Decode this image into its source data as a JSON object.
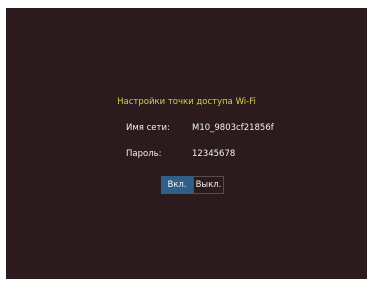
{
  "dialog": {
    "title": "Настройки точки доступа Wi-Fi",
    "network_name_label": "Имя сети:",
    "network_name_value": "M10_9803cf21856f",
    "password_label": "Пароль:",
    "password_value": "12345678",
    "on_button_label": "Вкл.",
    "off_button_label": "Выкл.",
    "selected": "on"
  },
  "colors": {
    "background": "#2b1b1d",
    "title": "#d9cd54",
    "text": "#f2f2f2",
    "selected_button": "#2f5f86"
  }
}
